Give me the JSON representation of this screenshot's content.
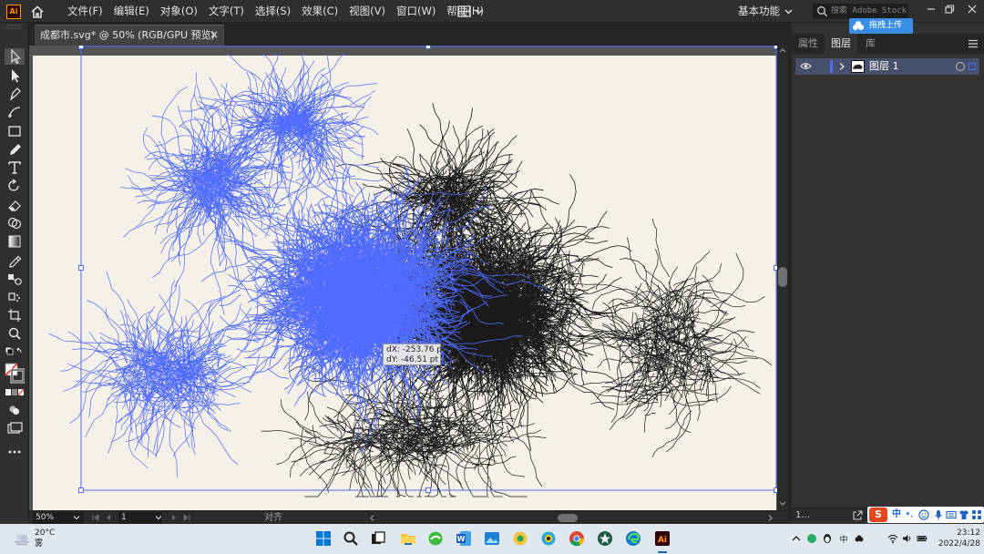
{
  "menubar": {
    "app_icon": "ai-logo-icon",
    "app_icon_label": "Ai",
    "items": [
      {
        "label": "文件(F)"
      },
      {
        "label": "编辑(E)"
      },
      {
        "label": "对象(O)"
      },
      {
        "label": "文字(T)"
      },
      {
        "label": "选择(S)"
      },
      {
        "label": "效果(C)"
      },
      {
        "label": "视图(V)"
      },
      {
        "label": "窗口(W)"
      },
      {
        "label": "帮助(H)"
      }
    ],
    "workspace_label": "基本功能",
    "search_placeholder": "搜索 Adobe Stock"
  },
  "upload_overlay": {
    "label": "拖拽上传"
  },
  "document_tab": {
    "title": "成都市.svg* @ 50% (RGB/GPU 预览)"
  },
  "canvas": {
    "move_tooltip": {
      "dx": "dX: -253.76 pt",
      "dy": "dY: -46.51 pt"
    },
    "artboard_color": "#f5f1e8",
    "selection_color": "#4f6bff",
    "road_color": "#1a1a1a"
  },
  "statusbar": {
    "zoom": "50%",
    "artboard_number": "1",
    "align_label": "对齐"
  },
  "right_panel": {
    "tabs": [
      {
        "label": "属性"
      },
      {
        "label": "图层"
      },
      {
        "label": "库"
      }
    ],
    "active_tab": "图层",
    "layers": [
      {
        "name": "图层 1"
      }
    ],
    "layer_count": "1..."
  },
  "ime_bar": {
    "logo": "S",
    "mode": "中",
    "punct": "•,"
  },
  "taskbar": {
    "weather": {
      "temp": "20°C",
      "desc": "雾"
    },
    "clock": {
      "time": "23:12",
      "date": "2022/4/28"
    },
    "active_app": "illustrator"
  }
}
